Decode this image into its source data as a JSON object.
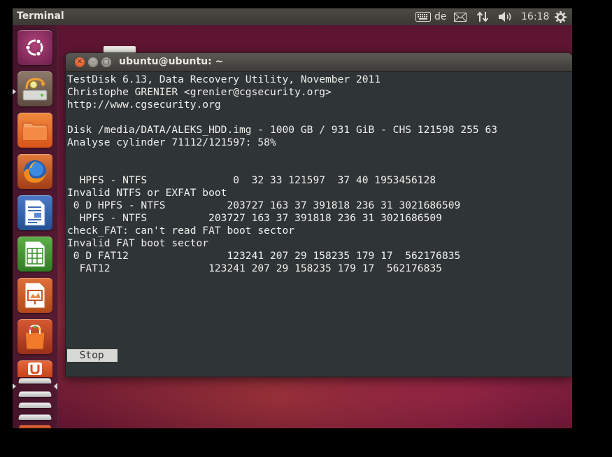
{
  "topbar": {
    "app_title": "Terminal",
    "keyboard_layout": "de",
    "clock": "16:18",
    "icons": [
      "keyboard-icon",
      "mail-icon",
      "network-icon",
      "volume-icon",
      "session-gear-icon"
    ]
  },
  "launcher": {
    "items": [
      {
        "name": "dash-home",
        "icon": "ubuntu-logo-icon"
      },
      {
        "name": "testdisk",
        "icon": "disk-recovery-icon"
      },
      {
        "name": "files",
        "icon": "folder-icon"
      },
      {
        "name": "firefox",
        "icon": "firefox-icon"
      },
      {
        "name": "writer",
        "icon": "libreoffice-writer-icon"
      },
      {
        "name": "calc",
        "icon": "libreoffice-calc-icon"
      },
      {
        "name": "impress",
        "icon": "libreoffice-impress-icon"
      },
      {
        "name": "software-center",
        "icon": "shopping-bag-icon"
      },
      {
        "name": "ubuntu-one",
        "icon": "ubuntu-one-icon"
      }
    ]
  },
  "window": {
    "title": "ubuntu@ubuntu: ~"
  },
  "terminal": {
    "lines": [
      "TestDisk 6.13, Data Recovery Utility, November 2011",
      "Christophe GRENIER <grenier@cgsecurity.org>",
      "http://www.cgsecurity.org",
      "",
      "Disk /media/DATA/ALEKS_HDD.img - 1000 GB / 931 GiB - CHS 121598 255 63",
      "Analyse cylinder 71112/121597: 58%",
      "",
      "",
      "  HPFS - NTFS              0  32 33 121597  37 40 1953456128",
      "Invalid NTFS or EXFAT boot",
      " 0 D HPFS - NTFS          203727 163 37 391818 236 31 3021686509",
      "  HPFS - NTFS          203727 163 37 391818 236 31 3021686509",
      "check_FAT: can't read FAT boot sector",
      "Invalid FAT boot sector",
      " 0 D FAT12                123241 207 29 158235 179 17  562176835",
      "  FAT12                123241 207 29 158235 179 17  562176835"
    ],
    "stop_label": "  Stop  "
  },
  "colors": {
    "terminal_bg": "#2f3436",
    "terminal_fg": "#f0f0ec",
    "panel_bg": "#3c3b37",
    "close_button": "#e95a2b"
  }
}
